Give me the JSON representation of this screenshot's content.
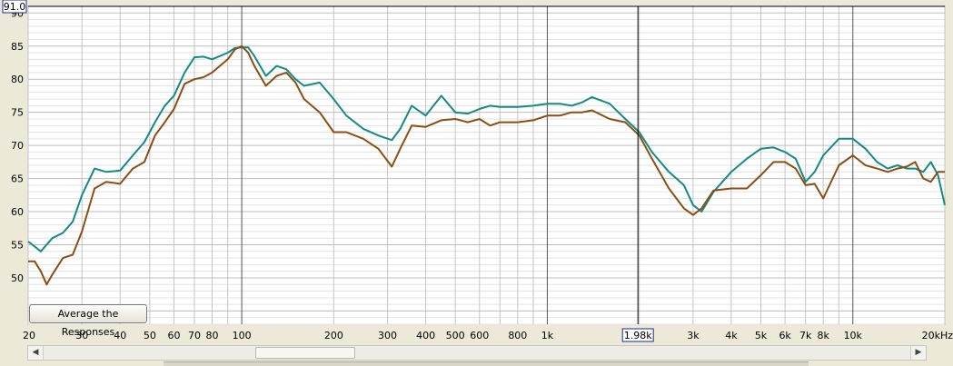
{
  "toolbar": {
    "average_label": "Average the Responses"
  },
  "chart_data": {
    "type": "line",
    "title": "",
    "xlabel": "",
    "ylabel": "",
    "x_scale": "log",
    "xlim": [
      20,
      20000
    ],
    "ylim": [
      43,
      91
    ],
    "grid": true,
    "y_ticks": [
      50,
      55,
      60,
      65,
      70,
      75,
      80,
      85,
      90
    ],
    "y_tick_labels": [
      "50",
      "55",
      "60",
      "65",
      "70",
      "75",
      "80",
      "85",
      "90"
    ],
    "x_ticks": [
      20,
      30,
      40,
      50,
      60,
      70,
      80,
      100,
      200,
      300,
      400,
      500,
      600,
      800,
      1000,
      3000,
      4000,
      5000,
      6000,
      7000,
      8000,
      10000,
      20000
    ],
    "x_tick_labels": [
      "20",
      "30",
      "40",
      "50",
      "60",
      "70",
      "80",
      "100",
      "200",
      "300",
      "400",
      "500",
      "600",
      "800",
      "1k",
      "3k",
      "4k",
      "5k",
      "6k",
      "7k",
      "8k",
      "10k",
      "20kHz"
    ],
    "cursor": {
      "x": 1980,
      "x_label": "1.98k",
      "y": 91.0,
      "y_label": "91.0"
    },
    "series": [
      {
        "color": "#148a84",
        "x": [
          20,
          22,
          24,
          26,
          28,
          30,
          33,
          36,
          40,
          44,
          48,
          52,
          56,
          60,
          65,
          70,
          75,
          80,
          90,
          95,
          100,
          105,
          110,
          120,
          130,
          140,
          150,
          160,
          180,
          200,
          220,
          250,
          280,
          310,
          330,
          360,
          400,
          450,
          500,
          550,
          600,
          650,
          700,
          800,
          900,
          1000,
          1100,
          1200,
          1300,
          1400,
          1600,
          1800,
          2000,
          2200,
          2500,
          2800,
          3000,
          3200,
          3500,
          4000,
          4500,
          5000,
          5500,
          6000,
          6500,
          7000,
          7500,
          8000,
          9000,
          10000,
          11000,
          12000,
          13000,
          14000,
          15000,
          16000,
          17000,
          18000,
          19000,
          20000
        ],
        "y": [
          55.5,
          54.0,
          56.0,
          56.8,
          58.5,
          62.5,
          66.5,
          66.0,
          66.2,
          68.5,
          70.5,
          73.5,
          76.0,
          77.5,
          81.0,
          83.3,
          83.4,
          83.0,
          84.0,
          84.7,
          84.8,
          84.8,
          83.5,
          80.5,
          82.0,
          81.5,
          80.0,
          79.0,
          79.5,
          77.0,
          74.5,
          72.5,
          71.5,
          70.8,
          72.5,
          76.0,
          74.5,
          77.5,
          75.0,
          74.8,
          75.5,
          76.0,
          75.8,
          75.8,
          76.0,
          76.3,
          76.3,
          76.0,
          76.5,
          77.3,
          76.3,
          74.0,
          72.0,
          69.0,
          66.0,
          64.0,
          61.0,
          60.0,
          63.0,
          66.0,
          68.0,
          69.5,
          69.7,
          69.0,
          68.0,
          64.5,
          66.0,
          68.5,
          71.0,
          71.0,
          69.5,
          67.5,
          66.5,
          67.0,
          66.5,
          66.5,
          66.0,
          67.5,
          65.5,
          61.0
        ]
      },
      {
        "color": "#8a4e12",
        "x": [
          20,
          21,
          22,
          23,
          24,
          26,
          28,
          30,
          33,
          36,
          40,
          44,
          48,
          52,
          56,
          60,
          65,
          70,
          75,
          80,
          90,
          95,
          100,
          105,
          110,
          120,
          130,
          140,
          150,
          160,
          180,
          200,
          220,
          250,
          280,
          310,
          330,
          360,
          400,
          450,
          500,
          550,
          600,
          650,
          700,
          800,
          900,
          1000,
          1100,
          1200,
          1300,
          1400,
          1600,
          1800,
          2000,
          2200,
          2500,
          2800,
          3000,
          3200,
          3500,
          4000,
          4500,
          5000,
          5500,
          6000,
          6500,
          7000,
          7500,
          8000,
          9000,
          10000,
          11000,
          12000,
          13000,
          14000,
          15000,
          16000,
          17000,
          18000,
          19000,
          20000
        ],
        "y": [
          52.5,
          52.5,
          51.0,
          49.0,
          50.5,
          53.0,
          53.5,
          57.0,
          63.5,
          64.5,
          64.2,
          66.5,
          67.5,
          71.5,
          73.5,
          75.5,
          79.3,
          80.0,
          80.3,
          81.0,
          83.0,
          84.5,
          85.0,
          84.0,
          82.0,
          79.0,
          80.5,
          81.0,
          79.5,
          77.0,
          75.0,
          72.0,
          72.0,
          71.0,
          69.5,
          66.8,
          69.5,
          73.0,
          72.8,
          73.8,
          74.0,
          73.5,
          74.0,
          73.0,
          73.5,
          73.5,
          73.8,
          74.5,
          74.5,
          75.0,
          75.0,
          75.3,
          74.0,
          73.5,
          71.5,
          68.0,
          63.5,
          60.5,
          59.5,
          60.5,
          63.2,
          63.5,
          63.5,
          65.5,
          67.5,
          67.5,
          66.5,
          64.0,
          64.2,
          62.0,
          67.0,
          68.5,
          67.0,
          66.5,
          66.0,
          66.5,
          66.8,
          67.5,
          65.0,
          64.5,
          66.0,
          66.0
        ]
      }
    ]
  }
}
